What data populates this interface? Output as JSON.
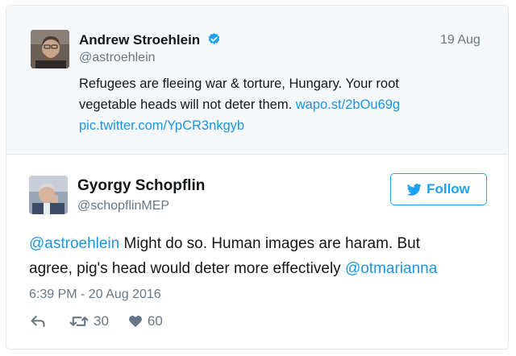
{
  "parent_tweet": {
    "author_name": "Andrew Stroehlein",
    "handle": "@astroehlein",
    "date": "19 Aug",
    "text_line1": "Refugees are fleeing war & torture, Hungary. Your root",
    "text_line2": "vegetable heads will not deter them.",
    "link1": "wapo.st/2bOu69g",
    "link2": "pic.twitter.com/YpCR3nkgyb",
    "verified_icon": "verified-badge"
  },
  "reply_tweet": {
    "author_name": "Gyorgy Schopflin",
    "handle": "@schopflinMEP",
    "follow_label": "Follow",
    "mention1": "@astroehlein",
    "text_line1": " Might do so. Human images are haram. But",
    "text_line2": "agree, pig's head would deter more effectively ",
    "mention2": "@otmarianna",
    "timestamp": "6:39 PM - 20 Aug 2016",
    "retweet_count": "30",
    "like_count": "60"
  },
  "colors": {
    "accent": "#1da1f2",
    "link": "#1b95e0",
    "muted": "#657786",
    "parent_bg": "#f5f8fa"
  }
}
